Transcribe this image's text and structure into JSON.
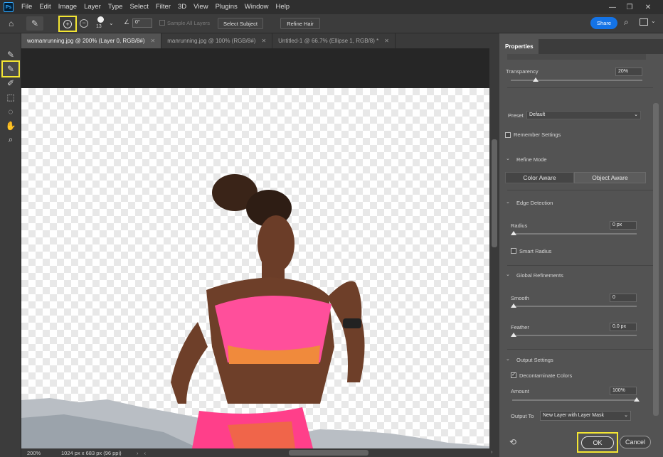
{
  "app": {
    "logo": "Ps"
  },
  "menu": [
    "File",
    "Edit",
    "Image",
    "Layer",
    "Type",
    "Select",
    "Filter",
    "3D",
    "View",
    "Plugins",
    "Window",
    "Help"
  ],
  "options": {
    "brush_size": "13",
    "angle": "0°",
    "sample_all_layers": "Sample All Layers",
    "select_subject": "Select Subject",
    "refine_hair": "Refine Hair",
    "share": "Share"
  },
  "tabs": [
    {
      "label": "womanrunning.jpg @ 200% (Layer 0, RGB/8#)",
      "active": true
    },
    {
      "label": "manrunning.jpg @ 100% (RGB/8#)",
      "active": false
    },
    {
      "label": "Untitled-1 @ 66.7% (Ellipse 1, RGB/8) *",
      "active": false
    }
  ],
  "status": {
    "zoom": "200%",
    "doc_info": "1024 px x 683 px (96 ppi)"
  },
  "panel": {
    "title": "Properties",
    "transparency_label": "Transparency",
    "transparency_value": "20%",
    "transparency_level": 0.2,
    "preset_label": "Preset",
    "preset_value": "Default",
    "remember_settings": "Remember Settings",
    "refine_mode": "Refine Mode",
    "color_aware": "Color Aware",
    "object_aware": "Object Aware",
    "edge_detection": "Edge Detection",
    "radius_label": "Radius",
    "radius_value": "0 px",
    "smart_radius": "Smart Radius",
    "global_refinements": "Global Refinements",
    "smooth_label": "Smooth",
    "smooth_value": "0",
    "feather_label": "Feather",
    "feather_value": "0.0 px",
    "output_settings": "Output Settings",
    "decontaminate": "Decontaminate Colors",
    "amount_label": "Amount",
    "amount_value": "100%",
    "output_to_label": "Output To",
    "output_to_value": "New Layer with Layer Mask",
    "ok": "OK",
    "cancel": "Cancel"
  },
  "colors": {
    "accent": "#1473e6",
    "highlight": "#f4e633"
  }
}
